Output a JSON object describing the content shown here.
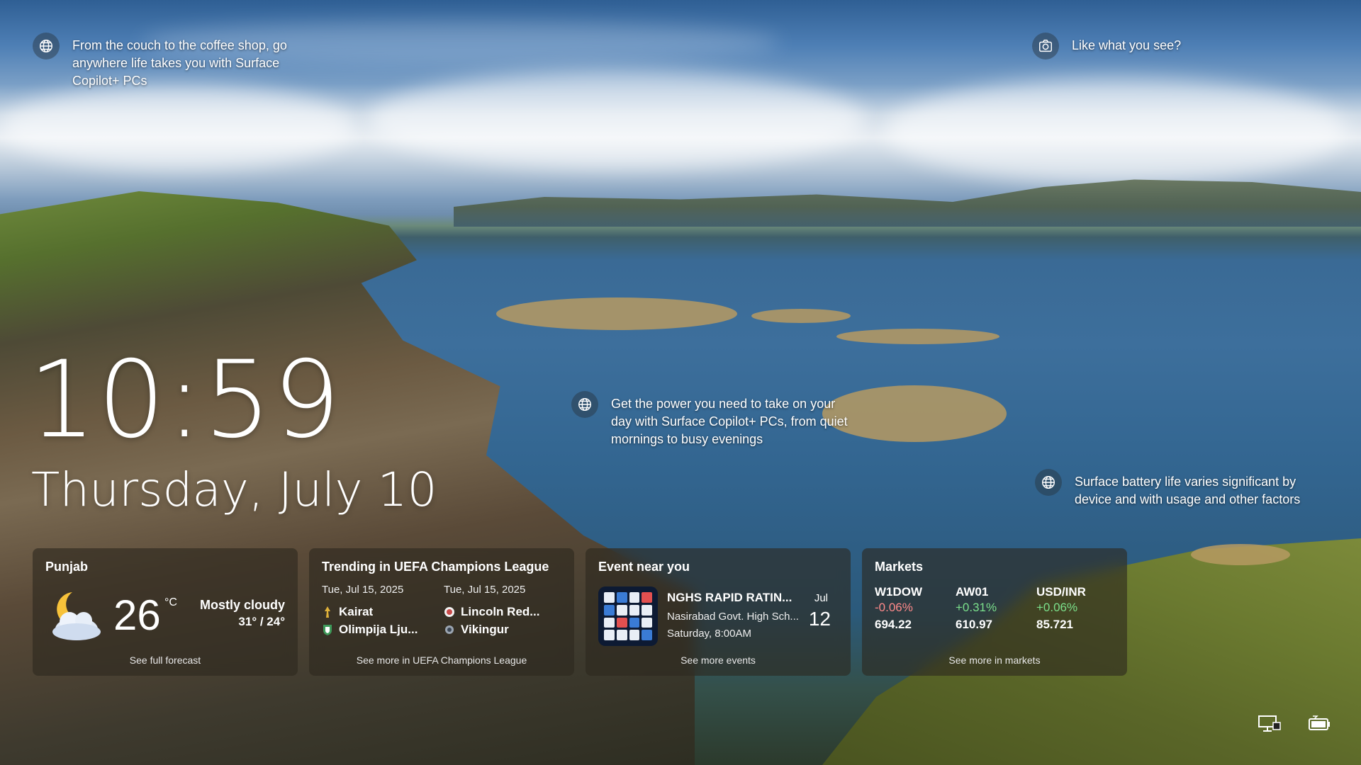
{
  "spotlight": {
    "top_left": "From the couch to the coffee shop, go anywhere life takes you with Surface Copilot+ PCs",
    "top_right": "Like what you see?",
    "middle": "Get the power you need to take on your day with Surface Copilot+ PCs, from quiet mornings to busy evenings",
    "right": "Surface battery life varies significant by device and with usage and other factors"
  },
  "clock": {
    "time": "10:59",
    "date": "Thursday, July 10"
  },
  "weather": {
    "location": "Punjab",
    "temp": "26",
    "unit": "°C",
    "condition": "Mostly cloudy",
    "range": "31° / 24°",
    "link": "See full forecast"
  },
  "sports": {
    "title": "Trending in UEFA Champions League",
    "matches": [
      {
        "date": "Tue, Jul 15, 2025",
        "home": "Kairat",
        "away": "Olimpija Lju..."
      },
      {
        "date": "Tue, Jul 15, 2025",
        "home": "Lincoln Red...",
        "away": "Vikingur"
      }
    ],
    "link": "See more in UEFA Champions League"
  },
  "event": {
    "title": "Event near you",
    "name": "NGHS RAPID RATIN...",
    "venue": "Nasirabad Govt. High Sch...",
    "when": "Saturday, 8:00AM",
    "month": "Jul",
    "day": "12",
    "link": "See more events"
  },
  "markets": {
    "title": "Markets",
    "stocks": [
      {
        "symbol": "W1DOW",
        "change": "-0.06%",
        "price": "694.22"
      },
      {
        "symbol": "AW01",
        "change": "+0.31%",
        "price": "610.97"
      },
      {
        "symbol": "USD/INR",
        "change": "+0.06%",
        "price": "85.721"
      }
    ],
    "link": "See more in markets"
  },
  "colors": {
    "negative": "#ff8a8a",
    "positive": "#7be08b"
  },
  "icons": [
    "globe-icon",
    "camera-icon",
    "weather-moon-cloud-icon",
    "network-icon",
    "battery-icon"
  ]
}
